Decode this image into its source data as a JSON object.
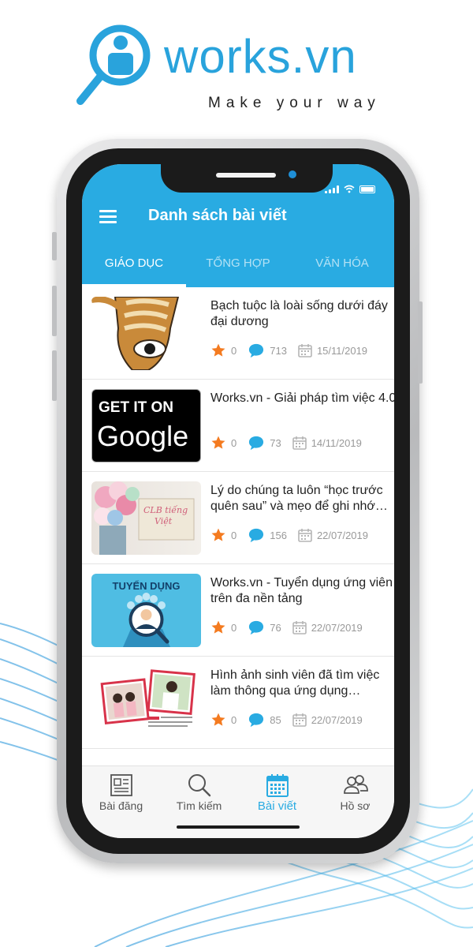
{
  "brand": {
    "name": "works.vn",
    "tagline": "Make your way"
  },
  "appbar": {
    "title": "Danh sách bài viết"
  },
  "tabs": [
    {
      "label": "GIÁO DỤC",
      "active": true
    },
    {
      "label": "TỔNG HỢP",
      "active": false
    },
    {
      "label": "VĂN HÓA",
      "active": false
    }
  ],
  "posts": [
    {
      "title": "Bạch tuộc là loài sống dưới đáy đại dương",
      "stars": "0",
      "comments": "713",
      "date": "15/11/2019",
      "thumb": "cartoon-squid"
    },
    {
      "title": "Works.vn - Giải pháp tìm việc 4.0",
      "stars": "0",
      "comments": "73",
      "date": "14/11/2019",
      "thumb": "get-it-on-google"
    },
    {
      "title": "Lý do chúng ta luôn “học trước quên sau” và mẹo để ghi nhớ “siêu tốc”",
      "stars": "0",
      "comments": "156",
      "date": "22/07/2019",
      "thumb": "clb-tieng-viet-flowers"
    },
    {
      "title": "Works.vn - Tuyển dụng ứng viên trên đa nền tảng",
      "stars": "0",
      "comments": "76",
      "date": "22/07/2019",
      "thumb": "tuyen-dung"
    },
    {
      "title": "Hình ảnh sinh viên đã tìm việc làm thông qua ứng dụng Works.vn",
      "stars": "0",
      "comments": "85",
      "date": "22/07/2019",
      "thumb": "students-photos"
    }
  ],
  "thumbs": {
    "get_it_on": "GET IT ON",
    "google": "Google",
    "clb": "CLB tiếng",
    "viet": "Việt",
    "tuyen_dung": "TUYỂN DỤNG"
  },
  "bottom_nav": [
    {
      "label": "Bài đăng",
      "icon": "newspaper-icon",
      "active": false
    },
    {
      "label": "Tìm kiếm",
      "icon": "search-icon",
      "active": false
    },
    {
      "label": "Bài viết",
      "icon": "calendar-icon",
      "active": true
    },
    {
      "label": "Hồ sơ",
      "icon": "profile-icon",
      "active": false
    }
  ],
  "colors": {
    "primary": "#29abe2",
    "star": "#f47b20",
    "comment": "#29abe2",
    "meta_text": "#999999"
  }
}
